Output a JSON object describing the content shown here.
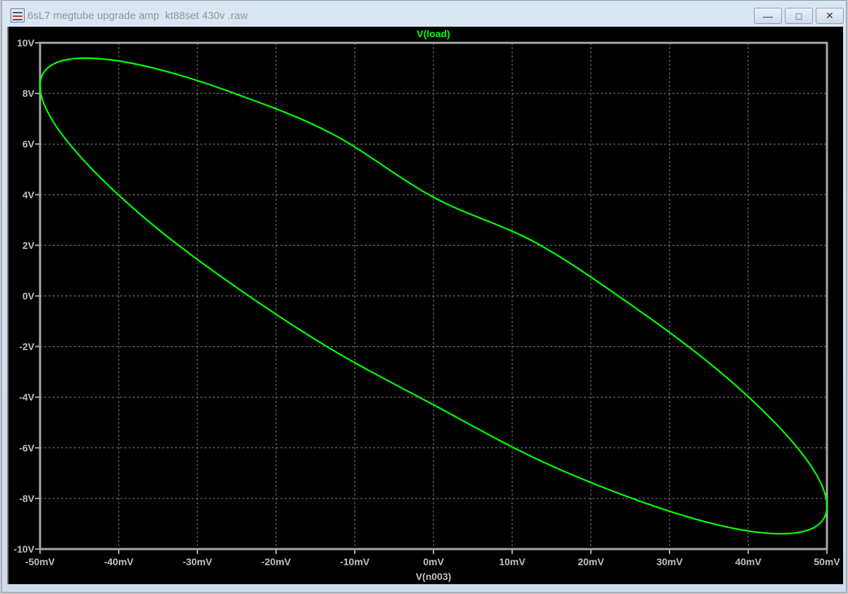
{
  "window": {
    "title": "6sL7 megtube upgrade amp  kt88set 430v .raw",
    "icon": "waveform-viewer-icon",
    "minimize_label": "—",
    "maximize_label": "□",
    "close_label": "✕"
  },
  "colors": {
    "trace": "#00ff00",
    "grid": "#808080",
    "axis": "#a8a8a8",
    "background": "#000000",
    "text": "#c0c0c0"
  },
  "chart_data": {
    "type": "line",
    "title": "V(load)",
    "xlabel": "V(n003)",
    "ylabel": "",
    "xlim": [
      -50,
      50
    ],
    "ylim": [
      -10,
      10
    ],
    "grid": true,
    "x_ticks": [
      "-50mV",
      "-40mV",
      "-30mV",
      "-20mV",
      "-10mV",
      "0mV",
      "10mV",
      "20mV",
      "30mV",
      "40mV",
      "50mV"
    ],
    "y_ticks": [
      "10V",
      "8V",
      "6V",
      "4V",
      "2V",
      "0V",
      "-2V",
      "-4V",
      "-6V",
      "-8V",
      "-10V"
    ],
    "series": [
      {
        "name": "V(load)",
        "closed": true,
        "x_units": "mV",
        "y_units": "V",
        "x": [
          50,
          48.3,
          43.3,
          35.4,
          25,
          12.9,
          0,
          -12.9,
          -25,
          -35.4,
          -43.3,
          -48.3,
          -50,
          -48.3,
          -43.3,
          -35.4,
          -25,
          -12.9,
          0,
          12.9,
          25,
          35.4,
          43.3,
          48.3
        ],
        "y": [
          -8.3,
          -6.87,
          -4.98,
          -2.74,
          -0.33,
          2.12,
          3.9,
          6.41,
          7.97,
          8.99,
          9.39,
          9.16,
          8.3,
          6.87,
          4.98,
          2.74,
          0.33,
          -2.12,
          -4.3,
          -6.41,
          -7.97,
          -8.99,
          -9.39,
          -9.16
        ]
      }
    ]
  }
}
